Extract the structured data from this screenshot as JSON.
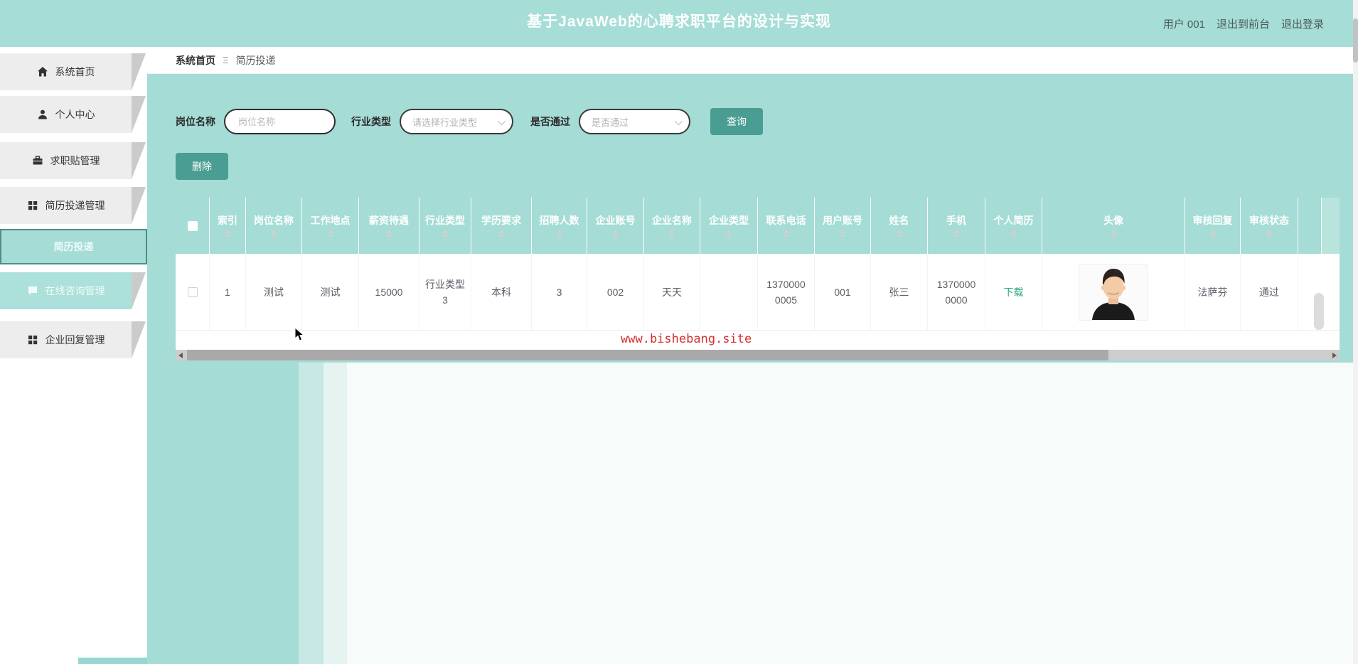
{
  "app": {
    "title": "基于JavaWeb的心聘求职平台的设计与实现",
    "user": "用户 001",
    "exit_to_front": "退出到前台",
    "logout": "退出登录"
  },
  "sidebar": {
    "items": [
      {
        "label": "系统首页",
        "icon": "home-icon"
      },
      {
        "label": "个人中心",
        "icon": "user-icon"
      },
      {
        "label": "求职贴管理",
        "icon": "briefcase-icon"
      },
      {
        "label": "简历投递管理",
        "icon": "grid-icon"
      },
      {
        "label": "简历投递",
        "icon": "",
        "state": "active"
      },
      {
        "label": "在线咨询管理",
        "icon": "chat-icon",
        "state": "faded"
      },
      {
        "label": "企业回复管理",
        "icon": "grid-icon"
      }
    ]
  },
  "breadcrumb": {
    "root": "系统首页",
    "separator": "Ξ",
    "current": "简历投递"
  },
  "filters": {
    "job_label": "岗位名称",
    "job_placeholder": "岗位名称",
    "industry_label": "行业类型",
    "industry_placeholder": "请选择行业类型",
    "pass_label": "是否通过",
    "pass_placeholder": "是否通过",
    "search_button": "查询",
    "delete_button": "删除"
  },
  "table": {
    "columns": [
      "索引",
      "岗位名称",
      "工作地点",
      "薪资待遇",
      "行业类型",
      "学历要求",
      "招聘人数",
      "企业账号",
      "企业名称",
      "企业类型",
      "联系电话",
      "用户账号",
      "姓名",
      "手机",
      "个人简历",
      "头像",
      "审核回复",
      "审核状态"
    ],
    "row": {
      "index": "1",
      "job_name": "测试",
      "work_place": "测试",
      "salary": "15000",
      "industry": "行业类型3",
      "education": "本科",
      "headcount": "3",
      "company_account": "002",
      "company_name": "天天",
      "company_type": "",
      "contact_phone": "13700000005",
      "user_account": "001",
      "name": "张三",
      "mobile": "13700000000",
      "resume_link": "下载",
      "avatar": "portrait-photo",
      "review_reply": "法萨芬",
      "review_status": "通过"
    }
  },
  "watermark": "www.bishebang.site",
  "colors": {
    "header_teal": "#a6ddd7",
    "content_teal": "#a5dcd6",
    "button_teal": "#4a9d92",
    "link_green": "#2fa882",
    "watermark_red": "#d43030"
  }
}
